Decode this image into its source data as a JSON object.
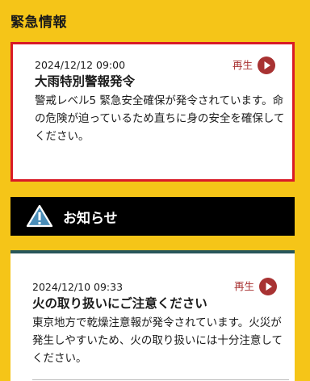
{
  "emergency": {
    "section_title": "緊急情報",
    "date": "2024/12/12 09:00",
    "title": "大雨特別警報発令",
    "body": "警戒レベル5 緊急安全確保が発令されています。命の危険が迫っているため直ちに身の安全を確保してください。",
    "play_label": "再生"
  },
  "notices": {
    "header_title": "お知らせ",
    "items": [
      {
        "date": "2024/12/10 09:33",
        "title": "火の取り扱いにご注意ください",
        "body": "東京地方で乾燥注意報が発令されています。火災が発生しやすいため、火の取り扱いには十分注意してください。",
        "play_label": "再生"
      }
    ]
  },
  "colors": {
    "background": "#f5c518",
    "emergency_border": "#d91a26",
    "play_accent": "#a83232",
    "notice_header_bg": "#000000",
    "notice_top_border": "#27565a"
  },
  "icons": {
    "play": "play-icon",
    "warning": "warning-icon"
  }
}
